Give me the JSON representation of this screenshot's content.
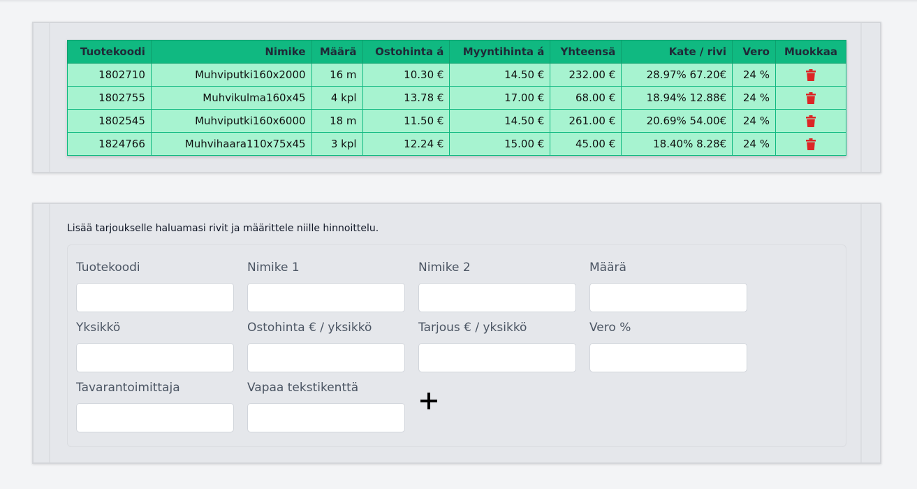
{
  "table": {
    "headers": [
      "Tuotekoodi",
      "Nimike",
      "Määrä",
      "Ostohinta á",
      "Myyntihinta á",
      "Yhteensä",
      "Kate / rivi",
      "Vero",
      "Muokkaa"
    ],
    "rows": [
      {
        "code": "1802710",
        "name": "Muhviputki160x2000",
        "qty": "16 m",
        "buy": "10.30 €",
        "sell": "14.50 €",
        "total": "232.00 €",
        "margin": "28.97% 67.20€",
        "tax": "24 %"
      },
      {
        "code": "1802755",
        "name": "Muhvikulma160x45",
        "qty": "4 kpl",
        "buy": "13.78 €",
        "sell": "17.00 €",
        "total": "68.00 €",
        "margin": "18.94% 12.88€",
        "tax": "24 %"
      },
      {
        "code": "1802545",
        "name": "Muhviputki160x6000",
        "qty": "18 m",
        "buy": "11.50 €",
        "sell": "14.50 €",
        "total": "261.00 €",
        "margin": "20.69% 54.00€",
        "tax": "24 %"
      },
      {
        "code": "1824766",
        "name": "Muhvihaara110x75x45",
        "qty": "3 kpl",
        "buy": "12.24 €",
        "sell": "15.00 €",
        "total": "45.00 €",
        "margin": "18.40% 8.28€",
        "tax": "24 %"
      }
    ],
    "delete_icon": "trash-icon",
    "header_color": "#10b981",
    "row_color": "#a7f3d0",
    "delete_color": "#dc2626"
  },
  "form": {
    "intro": "Lisää tarjoukselle haluamasi rivit ja määrittele niille hinnoittelu.",
    "fields": {
      "code": {
        "label": "Tuotekoodi",
        "value": ""
      },
      "name1": {
        "label": "Nimike 1",
        "value": ""
      },
      "name2": {
        "label": "Nimike 2",
        "value": ""
      },
      "qty": {
        "label": "Määrä",
        "value": ""
      },
      "unit": {
        "label": "Yksikkö",
        "value": ""
      },
      "buy": {
        "label": "Ostohinta € / yksikkö",
        "value": ""
      },
      "offer": {
        "label": "Tarjous € / yksikkö",
        "value": ""
      },
      "tax": {
        "label": "Vero %",
        "value": ""
      },
      "supplier": {
        "label": "Tavarantoimittaja",
        "value": ""
      },
      "free_text": {
        "label": "Vapaa tekstikenttä",
        "value": ""
      }
    },
    "add_icon": "plus-icon"
  }
}
